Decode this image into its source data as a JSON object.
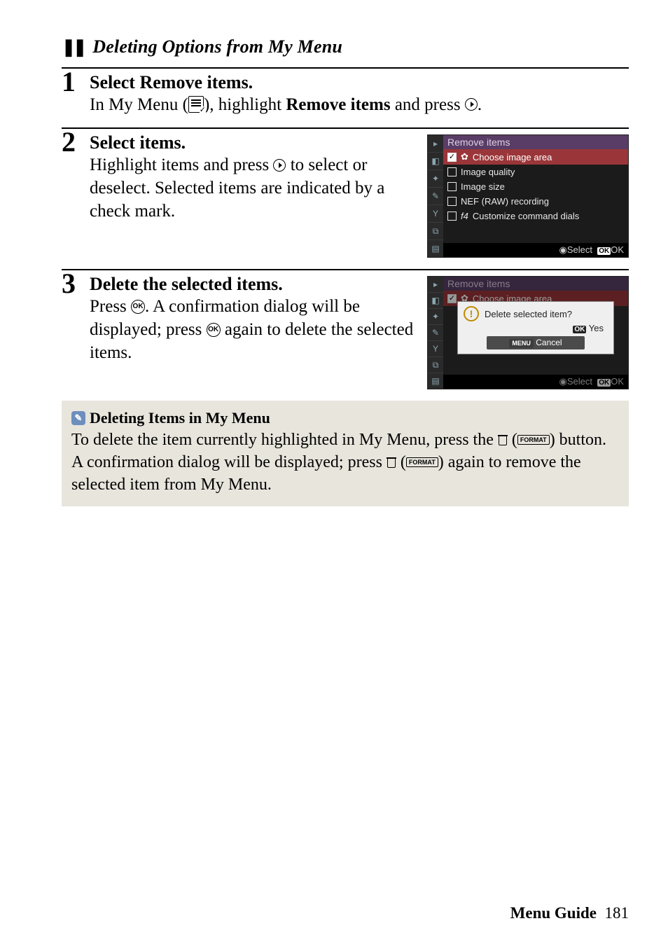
{
  "sectionTitle": "Deleting Options from My Menu",
  "steps": [
    {
      "num": "1",
      "titlePrefix": "Select ",
      "titleBold": "Remove items.",
      "bodyParts": {
        "p1": "In My Menu (",
        "p2": "), highlight ",
        "bold": "Remove items",
        "p3": " and press ",
        "p4": "."
      }
    },
    {
      "num": "2",
      "title": "Select items.",
      "body": {
        "p1": "Highlight items and press ",
        "p2": " to select or deselect.  Selected items are indicated by a check mark."
      },
      "screenshot": {
        "header": "Remove items",
        "items": [
          {
            "checked": true,
            "icon": "✿",
            "label": "Choose image area"
          },
          {
            "checked": false,
            "icon": "",
            "label": "Image quality"
          },
          {
            "checked": false,
            "icon": "",
            "label": "Image size"
          },
          {
            "checked": false,
            "icon": "",
            "label": "NEF (RAW) recording"
          },
          {
            "checked": false,
            "icon": "f4",
            "label": "Customize command dials",
            "italicIcon": true
          }
        ],
        "footer": {
          "select": "Select",
          "ok": "OK"
        }
      }
    },
    {
      "num": "3",
      "title": "Delete the selected items.",
      "body": {
        "p1": "Press ",
        "p2": ".  A confirmation dialog will be displayed; press ",
        "p3": " again to delete the selected items."
      },
      "screenshot": {
        "header": "Remove items",
        "dialog": {
          "msg": "Delete selected item?",
          "yes": "Yes",
          "cancel": "Cancel"
        },
        "footer": {
          "select": "Select",
          "ok": "OK"
        },
        "topItem": {
          "icon": "✿",
          "label": "Choose image area"
        }
      }
    }
  ],
  "note": {
    "title": "Deleting Items in My Menu",
    "body": {
      "p1": "To delete the item currently highlighted in My Menu, press the ",
      "p2": " (",
      "p3": ") button.  A confirmation dialog will be displayed; press ",
      "p4": " (",
      "p5": ") again to remove the selected item from My Menu."
    },
    "format": "FORMAT"
  },
  "footer": {
    "label": "Menu Guide",
    "page": "181"
  },
  "ui": {
    "okGlyph": "OK",
    "menuBadge": "MENU"
  }
}
